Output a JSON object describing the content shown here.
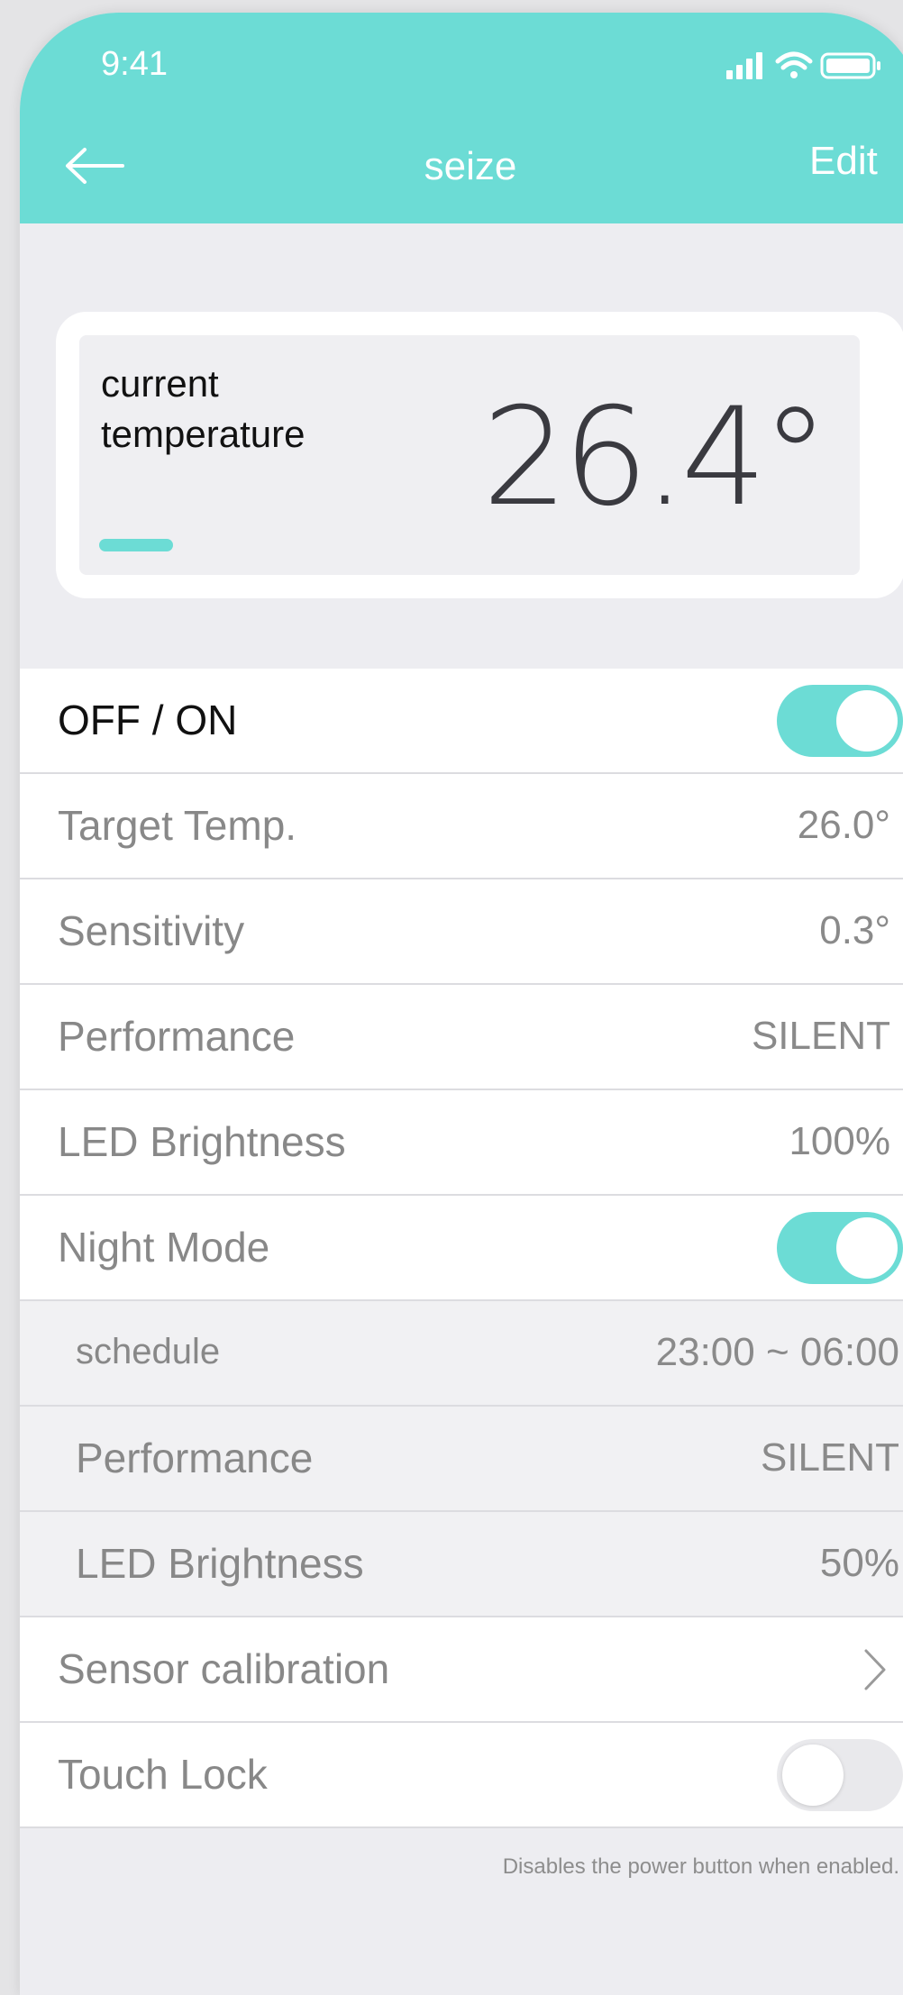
{
  "status_bar": {
    "time": "9:41"
  },
  "header": {
    "title": "seize",
    "edit_label": "Edit"
  },
  "temperature_card": {
    "label_line1": "current",
    "label_line2": "temperature",
    "value": "26.4°"
  },
  "settings": {
    "power": {
      "label": "OFF / ON",
      "on": true
    },
    "target_temp": {
      "label": "Target Temp.",
      "value": "26.0°"
    },
    "sensitivity": {
      "label": "Sensitivity",
      "value": "0.3°"
    },
    "performance": {
      "label": "Performance",
      "value": "SILENT"
    },
    "led_brightness": {
      "label": "LED Brightness",
      "value": "100%"
    },
    "night_mode": {
      "label": "Night Mode",
      "on": true
    },
    "night_schedule": {
      "label": "schedule",
      "value": "23:00 ~ 06:00"
    },
    "night_performance": {
      "label": "Performance",
      "value": "SILENT"
    },
    "night_led_brightness": {
      "label": "LED Brightness",
      "value": "50%"
    },
    "sensor_calibration": {
      "label": "Sensor calibration"
    },
    "touch_lock": {
      "label": "Touch Lock",
      "on": false,
      "hint": "Disables the power button when enabled."
    }
  },
  "colors": {
    "accent": "#6cdcd5",
    "background": "#ededf1",
    "card": "#ffffff",
    "secondary_text": "#888888"
  }
}
